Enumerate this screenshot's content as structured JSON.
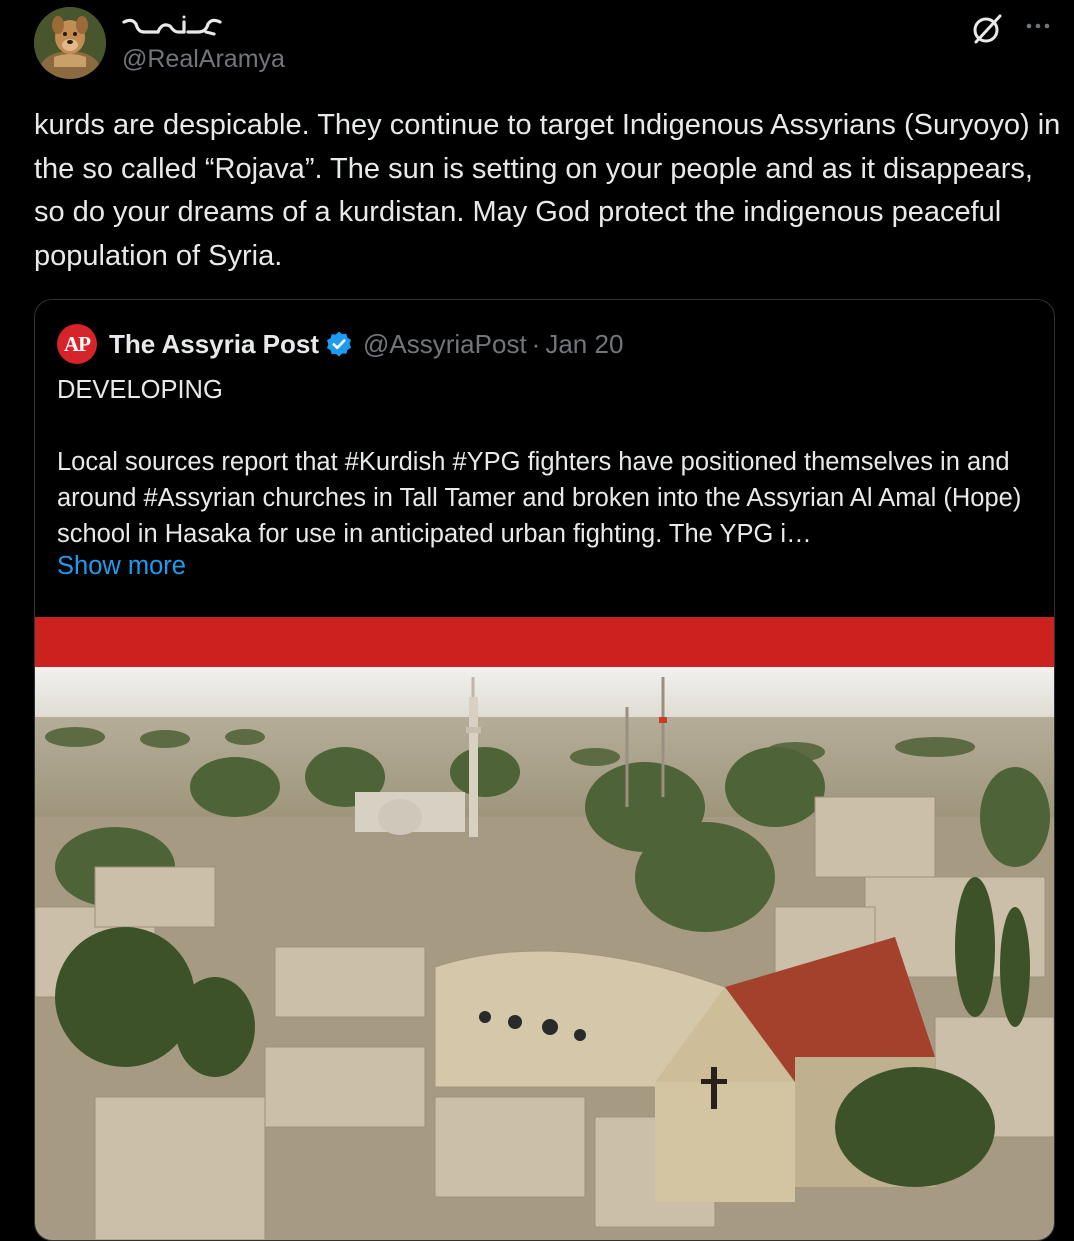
{
  "post": {
    "author": {
      "display_name": "ܐܪܡܝܐ",
      "handle": "@RealAramya",
      "avatar_icon": "dog-avatar"
    },
    "actions": {
      "grok_icon": "grok-icon",
      "more_icon": "more-dots-icon"
    },
    "text": "kurds are despicable. They continue to target Indigenous Assyrians (Suryoyo) in the so called “Rojava”. The sun is setting on your people and as it disappears, so do your dreams of a kurdistan. May God protect the indigenous peaceful population of Syria."
  },
  "quote": {
    "logo_text": "AP",
    "name": "The Assyria Post",
    "verified_icon": "verified-badge-icon",
    "handle": "@AssyriaPost",
    "separator": "·",
    "date": "Jan 20",
    "text": "DEVELOPING\n\nLocal sources report that #Kurdish #YPG fighters have positioned themselves in and around #Assyrian churches in Tall Tamer and broken into the Assyrian Al Amal (Hope) school in Hasaka for use in anticipated urban fighting. The YPG i…",
    "show_more": "Show more",
    "image": {
      "band_color": "#cc221f",
      "subject": "aerial-town-photo"
    }
  },
  "colors": {
    "background": "#000000",
    "text": "#e7e9ea",
    "secondary": "#71767b",
    "link": "#1d9bf0",
    "border": "#2f3336"
  }
}
